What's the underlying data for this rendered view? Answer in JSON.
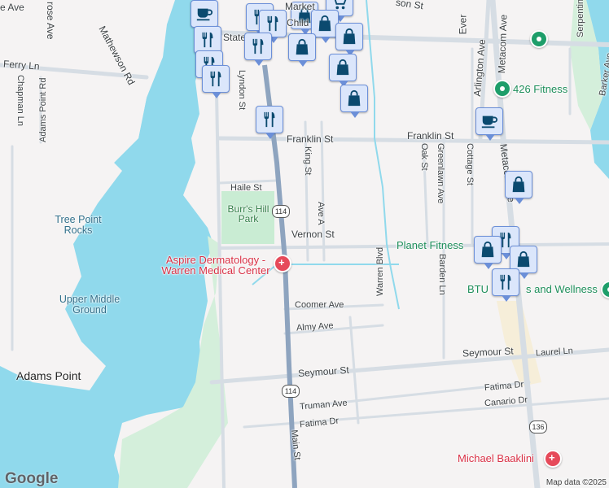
{
  "map": {
    "colors": {
      "water": "#90d9ec",
      "land": "#f5f3f3",
      "park": "#c9ecd3",
      "road": "#d6dde4",
      "highway": "#8ea4bf",
      "marker_bg": "#dbe6fb",
      "marker_icon": "#0b4a6f",
      "poi_green": "#1e8e5a",
      "poi_red": "#d93045"
    },
    "streets": {
      "rose_ave": "rose Ave",
      "ave_top": "e Ave",
      "ferry_ln": "Ferry Ln",
      "chapman_ln": "Chapman Ln",
      "adams_point_rd": "Adams Point Rd",
      "mathewson_rd": "Mathewson Rd",
      "lyndon_st": "Lyndon St",
      "state_st": "State",
      "market_st": "Market",
      "child_st": "Child",
      "franklin_st_1": "Franklin St",
      "franklin_st_2": "Franklin St",
      "king_st": "King St",
      "haile_st": "Haile St",
      "ave_a": "Ave A",
      "vernon_st": "Vernon St",
      "coomer_ave": "Coomer Ave",
      "almy_ave": "Almy Ave",
      "seymour_st_1": "Seymour St",
      "seymour_st_2": "Seymour St",
      "truman_ave": "Truman Ave",
      "fatima_dr_1": "Fatima Dr",
      "fatima_dr_2": "Fatima Dr",
      "canario_dr": "Canario Dr",
      "laurel_ln": "Laurel Ln",
      "main_st": "Main St",
      "warren_blvd": "Warren Blvd",
      "oak_st": "Oak St",
      "greenlawn_ave": "Greenlawn Ave",
      "barden_ln": "Barden Ln",
      "cottage_st": "Cottage St",
      "arlington_ave": "Arlington Ave",
      "metacom_ave_1": "Metacom Ave",
      "metacom_ave_2": "Metacom Ave",
      "serpentine": "Serpentine",
      "barker_ave": "Barker Ave",
      "ever": "Ever",
      "son_st": "son St"
    },
    "places": {
      "tree_point_rocks": "Tree Point Rocks",
      "upper_middle_ground": "Upper Middle Ground",
      "adams_point": "Adams Point",
      "burrs_hill_park": "Burr's Hill Park",
      "aspire": "Aspire Dermatology - Warren Medical Center",
      "fitness_426": "426 Fitness",
      "planet_fitness": "Planet Fitness",
      "btu_wellness": "BTU",
      "btu_wellness_tail": "s and Wellness",
      "michael_baaklini": "Michael Baaklini"
    },
    "route_shields": [
      "114",
      "114",
      "136"
    ],
    "markers": [
      "coffee",
      "shopping-cart",
      "restaurant",
      "restaurant",
      "restaurant",
      "restaurant",
      "restaurant",
      "restaurant",
      "shopping-bag",
      "shopping-bag",
      "shopping-bag",
      "shopping-bag",
      "shopping-bag",
      "shopping-bag",
      "restaurant",
      "coffee",
      "shopping-bag",
      "restaurant",
      "shopping-bag",
      "shopping-bag",
      "restaurant"
    ],
    "logo": "Google",
    "attribution": "Map data ©2025"
  }
}
